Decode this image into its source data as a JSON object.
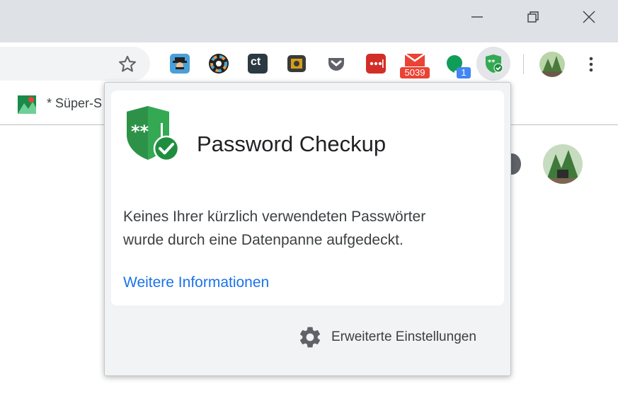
{
  "window": {
    "minimize_icon": "minimize-icon",
    "restore_icon": "restore-icon",
    "close_icon": "close-icon"
  },
  "toolbar": {
    "bookmark_star_icon": "star-icon",
    "extensions": [
      {
        "name": "spy-extension-icon"
      },
      {
        "name": "color-wheel-extension-icon"
      },
      {
        "name": "ct-extension-icon",
        "label": "ct"
      },
      {
        "name": "camera-extension-icon"
      },
      {
        "name": "pocket-icon"
      },
      {
        "name": "lastpass-icon"
      },
      {
        "name": "mail-checker-icon",
        "badge": "5039"
      },
      {
        "name": "hangouts-icon",
        "badge": "1"
      },
      {
        "name": "password-checkup-extension-icon"
      }
    ],
    "menu_icon": "more-vert-icon"
  },
  "bookmarks": {
    "item_label": "* Süper-S"
  },
  "popup": {
    "title": "Password Checkup",
    "body_line1": "Keines Ihrer kürzlich verwendeten Passwörter",
    "body_line2": "wurde durch eine Datenpanne aufgedeckt.",
    "link": "Weitere Informationen",
    "settings_label": "Erweiterte Einstellungen"
  },
  "colors": {
    "accent_link": "#1a73e8",
    "shield_green": "#34a853",
    "badge_red": "#ea4335",
    "badge_blue": "#4285f4"
  }
}
